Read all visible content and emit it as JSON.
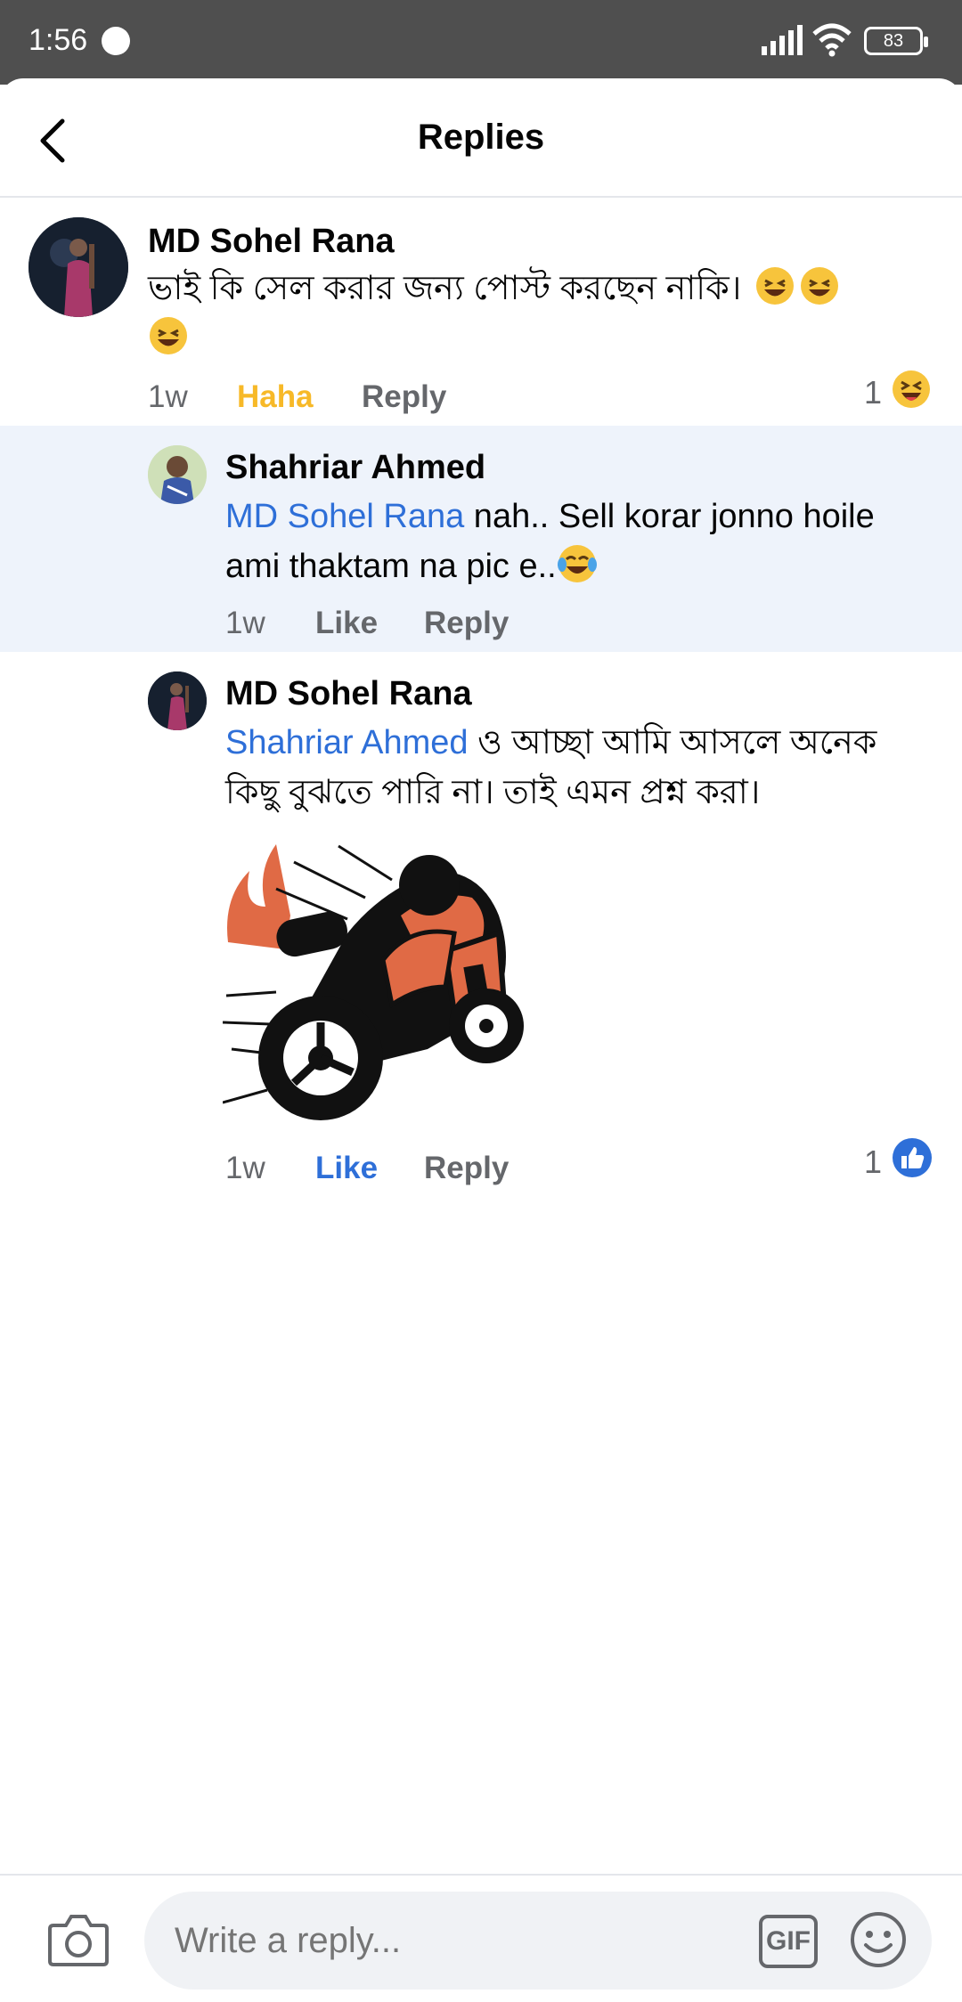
{
  "status_bar": {
    "time": "1:56",
    "battery": "83"
  },
  "header": {
    "title": "Replies"
  },
  "comment": {
    "author": "MD Sohel Rana",
    "text": "ভাই কি সেল করার জন্য পোস্ট করছেন নাকি।",
    "time": "1w",
    "reaction_label": "Haha",
    "reply_label": "Reply",
    "reaction_count": "1"
  },
  "replies": [
    {
      "author": "Shahriar Ahmed",
      "mention": "MD Sohel Rana",
      "text_line1": " nah.. Sell korar jonno hoile",
      "text_line2": "ami thaktam na pic e..",
      "time": "1w",
      "like_label": "Like",
      "reply_label": "Reply"
    },
    {
      "author": "MD Sohel Rana",
      "mention": "Shahriar Ahmed",
      "text_line1": " ও আচ্ছা আমি আসলে অনেক",
      "text_line2": "কিছু বুঝতে পারি না। তাই এমন প্রশ্ন করা।",
      "time": "1w",
      "like_label": "Like",
      "reply_label": "Reply",
      "reaction_count": "1"
    }
  ],
  "composer": {
    "placeholder": "Write a reply...",
    "gif_label": "GIF"
  },
  "colors": {
    "accent_blue": "#2e6fd8",
    "haha_yellow": "#f7b928",
    "highlight_bg": "#eef3fb"
  }
}
